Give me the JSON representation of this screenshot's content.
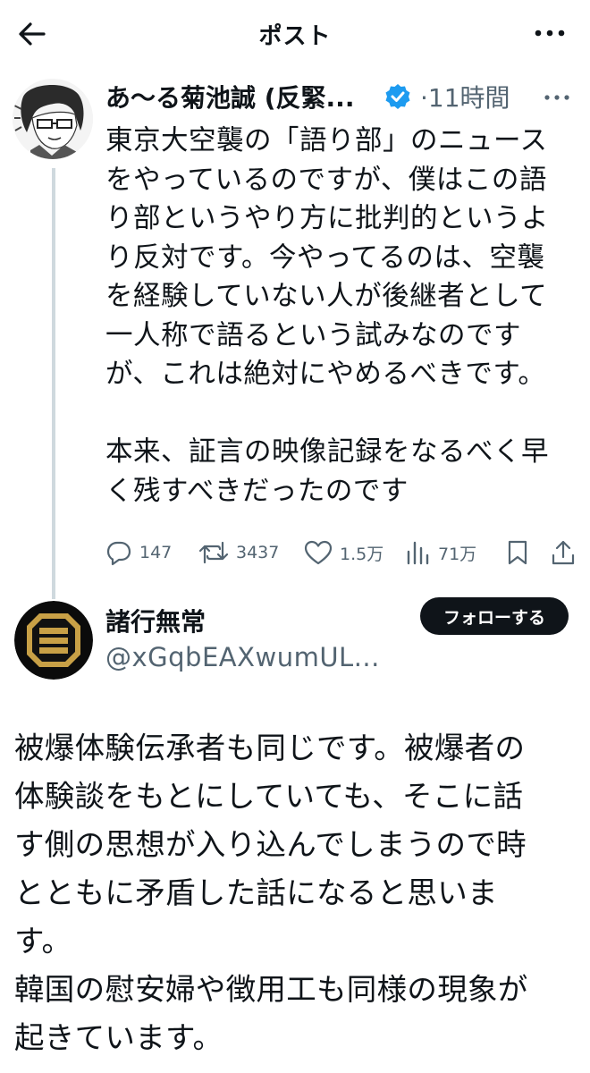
{
  "header": {
    "title": "ポスト"
  },
  "post": {
    "author_name": "あ〜る菊池誠 (反緊...",
    "time": "·11時間",
    "text": "東京大空襲の「語り部」のニュース\nをやっているのですが、僕はこの語\nり部というやり方に批判的というよ\nり反対です。今やってるのは、空襲\nを経験していない人が後継者として\n一人称で語るという試みなのです\nが、これは絶対にやめるべきです。\n\n本来、証言の映像記録をなるべく早\nく残すべきだったのです",
    "actions": {
      "replies": "147",
      "reposts": "3437",
      "likes": "1.5万",
      "views": "71万"
    }
  },
  "reply": {
    "author_name": "諸行無常",
    "handle": "@xGqbEAXwumUL...",
    "follow_label": "フォローする",
    "text": "被爆体験伝承者も同じです。被爆者の\n体験談をもとにしていても、そこに話\nす側の思想が入り込んでしまうので時\nとともに矛盾した話になると思いま\nす。\n韓国の慰安婦や徴用工も同様の現象が\n起きています。"
  },
  "colors": {
    "accent": "#1d9bf0",
    "muted": "#536471",
    "text": "#0f1419",
    "avatar_gold": "#c8a046"
  }
}
